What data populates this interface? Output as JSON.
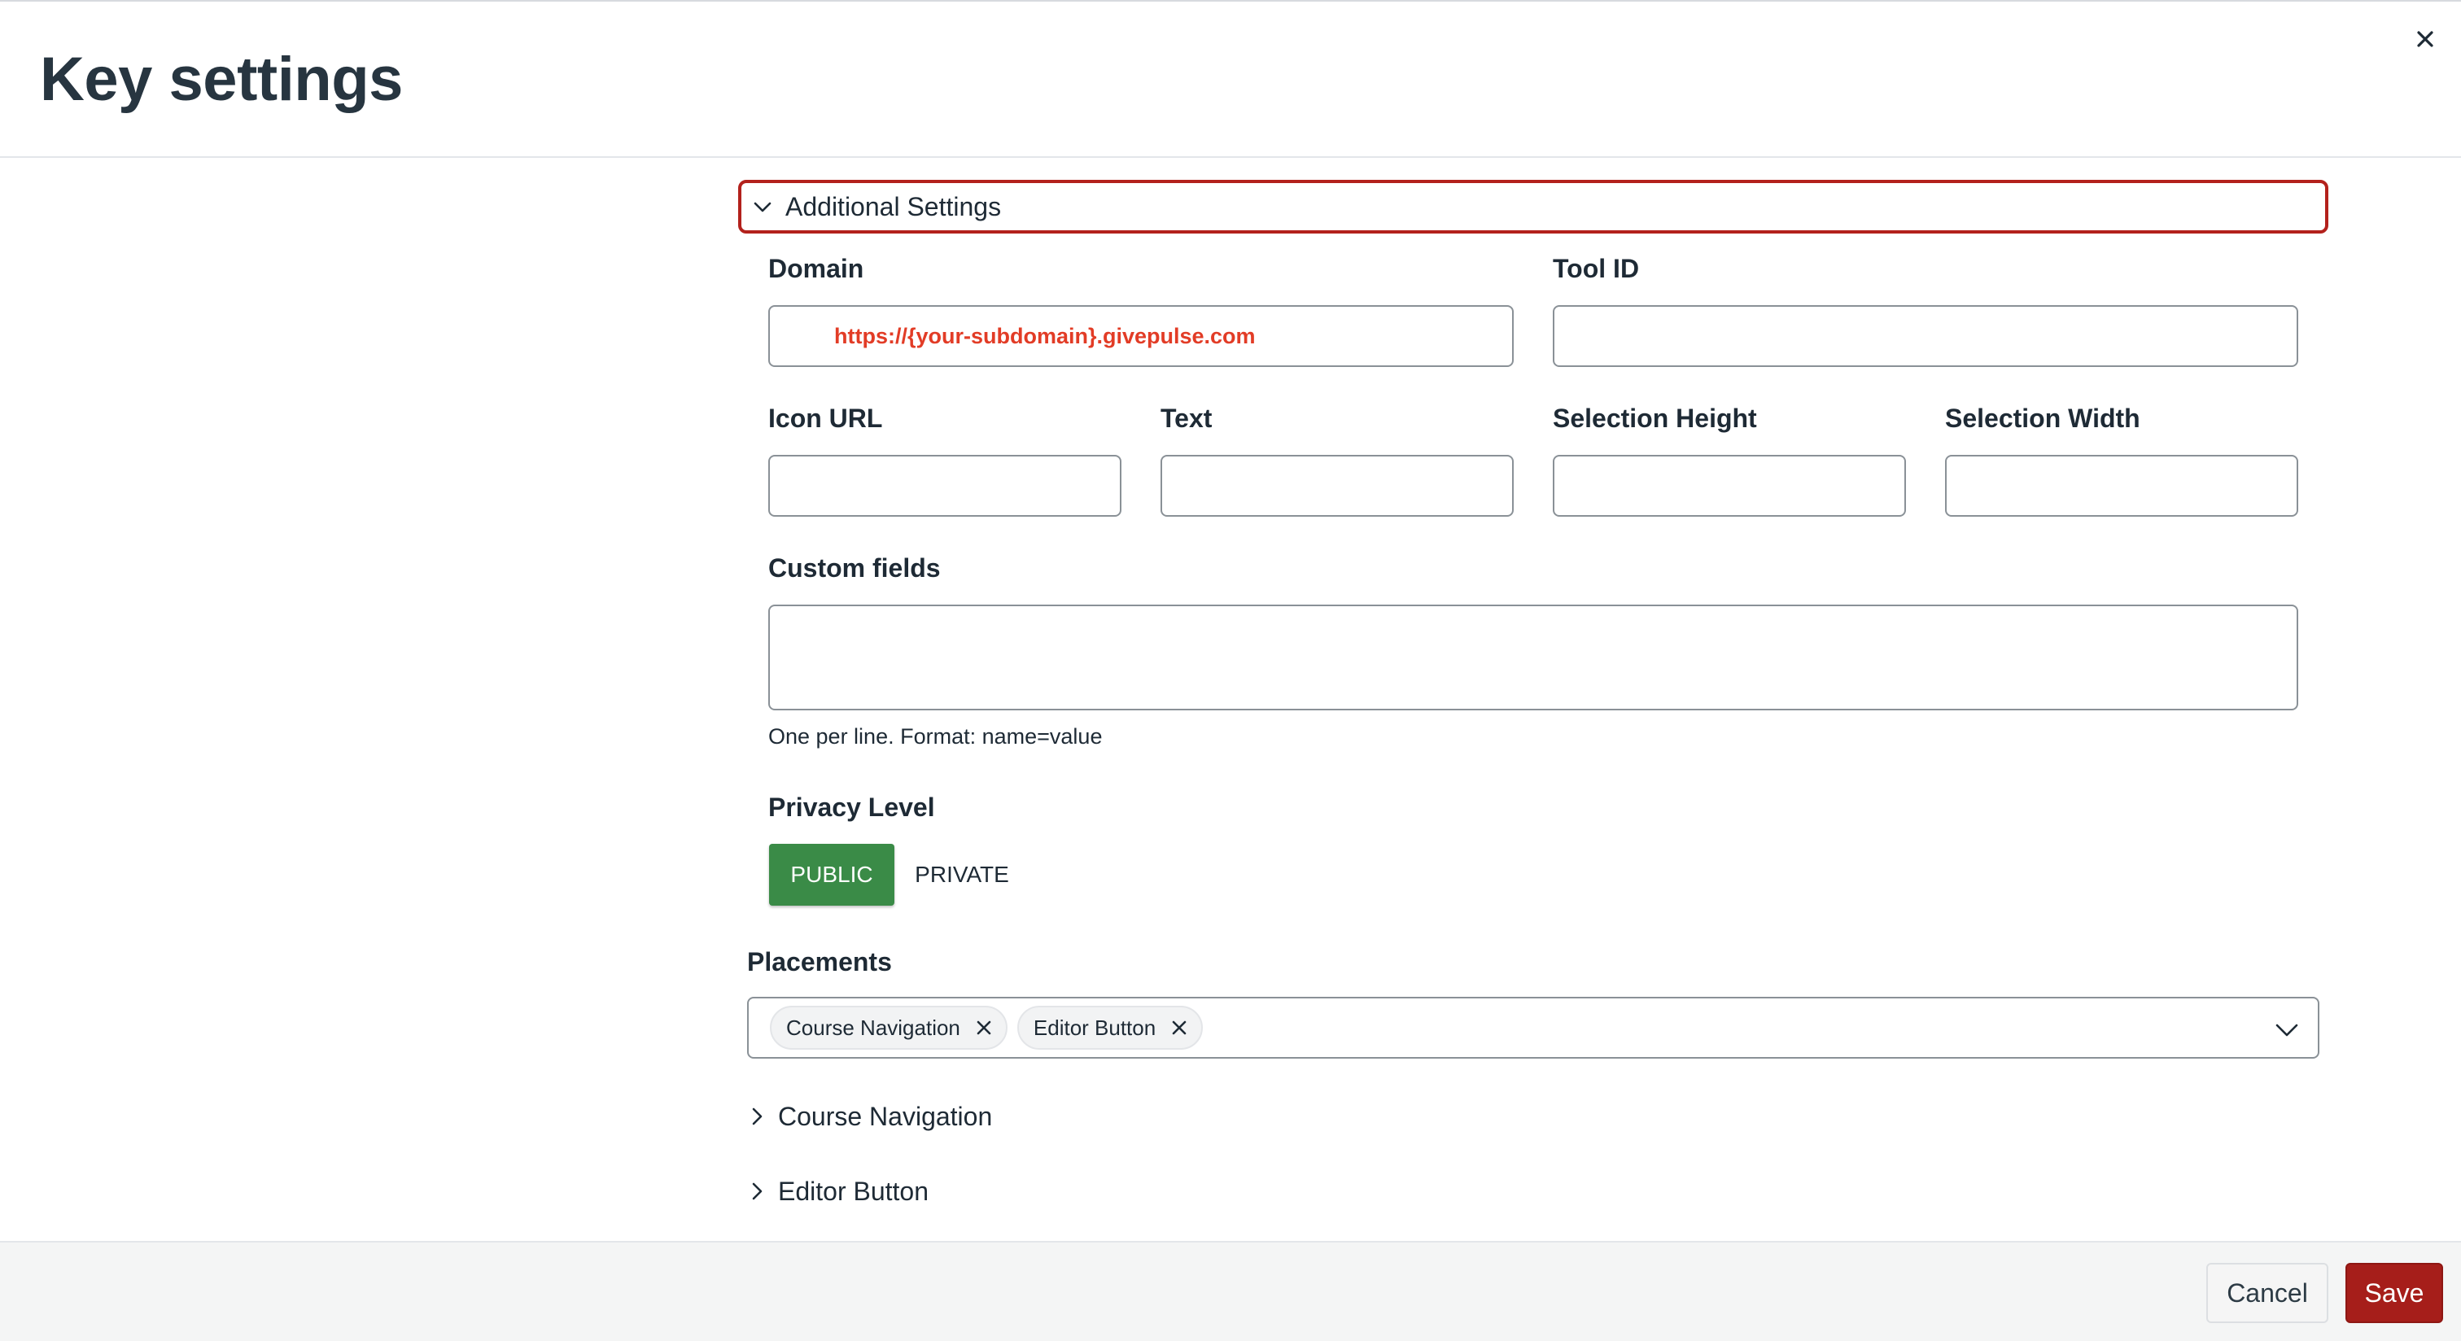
{
  "dialog": {
    "title": "Key settings",
    "close_icon": "close-icon"
  },
  "additional_settings": {
    "label": "Additional Settings",
    "expanded": true,
    "chevron_icon": "chevron-down-icon"
  },
  "fields": {
    "domain": {
      "label": "Domain",
      "value": "https://{your-subdomain}.givepulse.com"
    },
    "tool_id": {
      "label": "Tool ID",
      "value": ""
    },
    "icon_url": {
      "label": "Icon URL",
      "value": ""
    },
    "text": {
      "label": "Text",
      "value": ""
    },
    "selection_height": {
      "label": "Selection Height",
      "value": ""
    },
    "selection_width": {
      "label": "Selection Width",
      "value": ""
    },
    "custom_fields": {
      "label": "Custom fields",
      "value": "",
      "hint": "One per line. Format: name=value"
    }
  },
  "privacy": {
    "label": "Privacy Level",
    "options": [
      "PUBLIC",
      "PRIVATE"
    ],
    "selected": "PUBLIC",
    "selected_color": "#3a8b47"
  },
  "placements": {
    "label": "Placements",
    "tags": [
      "Course Navigation",
      "Editor Button"
    ],
    "tag_remove_icon": "close-icon",
    "dropdown_icon": "chevron-down-icon"
  },
  "sections": [
    {
      "label": "Course Navigation",
      "icon": "chevron-right-icon"
    },
    {
      "label": "Editor Button",
      "icon": "chevron-right-icon"
    }
  ],
  "footer": {
    "cancel_label": "Cancel",
    "save_label": "Save"
  },
  "colors": {
    "focus_ring": "#b3211c",
    "primary_button": "#a61e1a",
    "domain_text": "#e23c26"
  }
}
